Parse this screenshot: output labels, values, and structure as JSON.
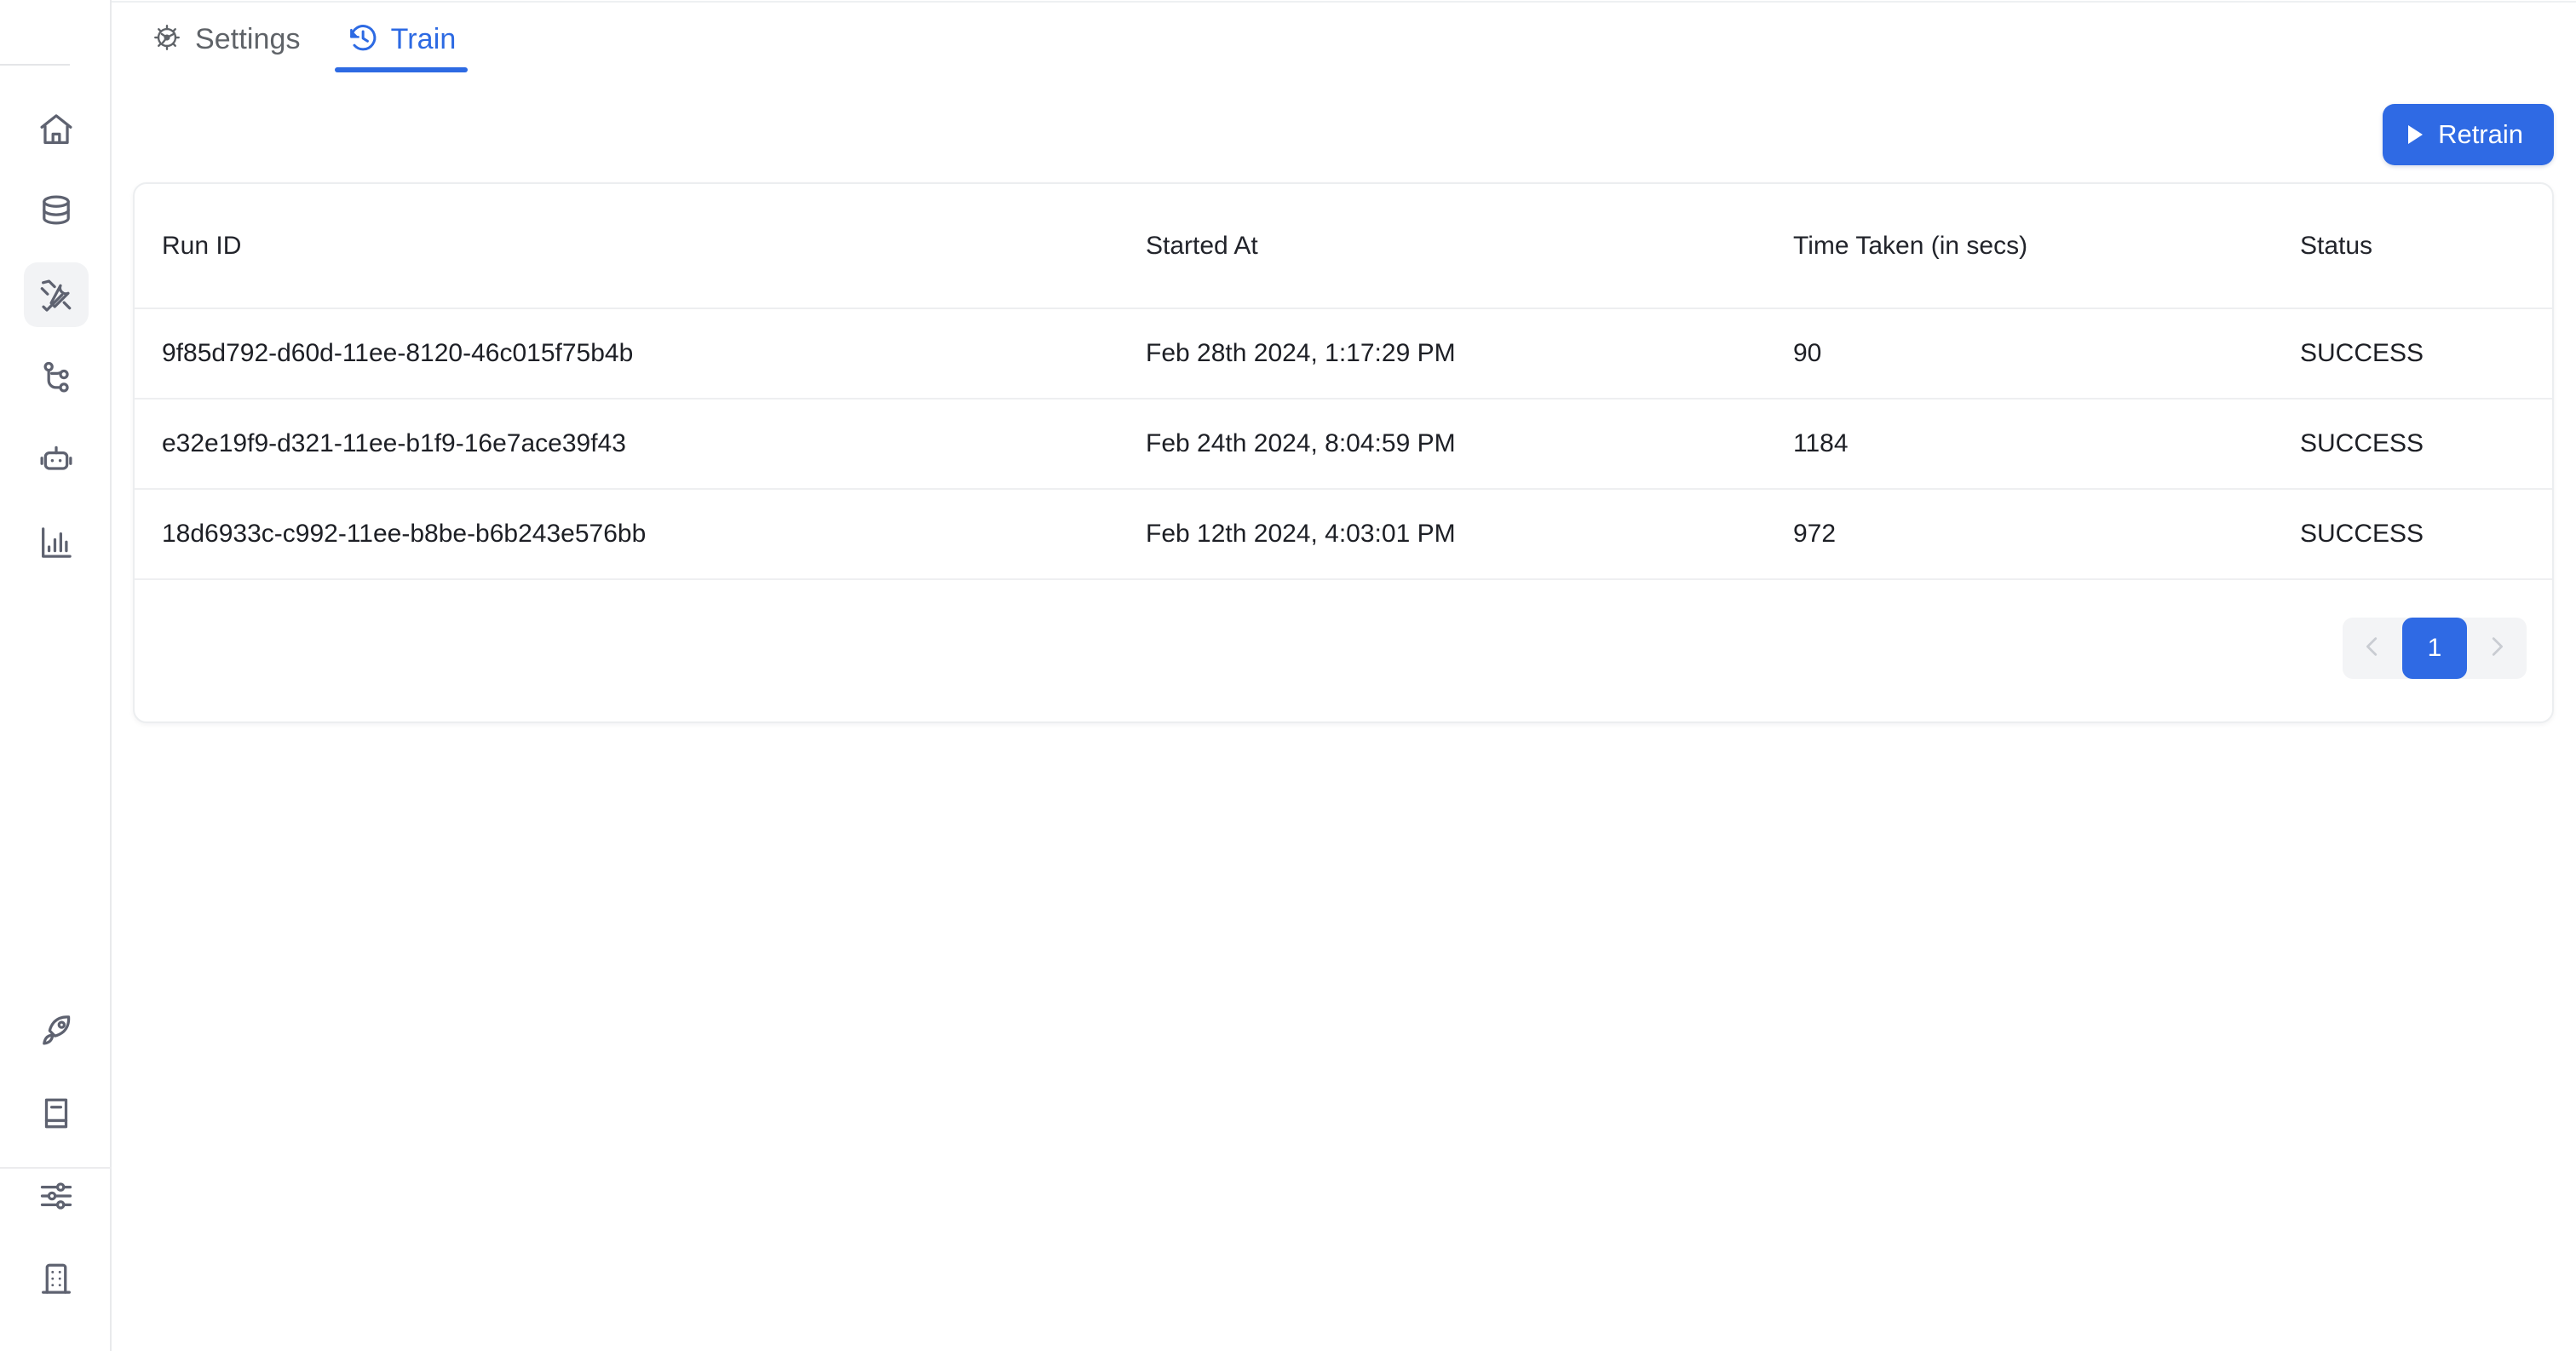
{
  "sidebar": {
    "top_items": [
      {
        "icon": "home-icon",
        "name": "sidebar-item-home",
        "active": false
      },
      {
        "icon": "database-icon",
        "name": "sidebar-item-datasets",
        "active": false
      },
      {
        "icon": "tools-icon",
        "name": "sidebar-item-tools",
        "active": true
      },
      {
        "icon": "git-branch-icon",
        "name": "sidebar-item-pipelines",
        "active": false
      },
      {
        "icon": "robot-icon",
        "name": "sidebar-item-agents",
        "active": false
      },
      {
        "icon": "bar-chart-icon",
        "name": "sidebar-item-analytics",
        "active": false
      }
    ],
    "bottom_items": [
      {
        "icon": "rocket-icon",
        "name": "sidebar-item-deploy",
        "active": false
      },
      {
        "icon": "book-icon",
        "name": "sidebar-item-docs",
        "active": false
      },
      {
        "icon": "sliders-icon",
        "name": "sidebar-item-settings",
        "active": false
      },
      {
        "icon": "building-icon",
        "name": "sidebar-item-organization",
        "active": false
      }
    ]
  },
  "tabs": [
    {
      "label": "Settings",
      "icon": "gear-icon",
      "active": false
    },
    {
      "label": "Train",
      "icon": "history-icon",
      "active": true
    }
  ],
  "toolbar": {
    "retrain_label": "Retrain",
    "retrain_icon": "play-icon"
  },
  "table": {
    "columns": [
      "Run ID",
      "Started At",
      "Time Taken (in secs)",
      "Status"
    ],
    "rows": [
      {
        "run_id": "9f85d792-d60d-11ee-8120-46c015f75b4b",
        "started_at": "Feb 28th 2024, 1:17:29 PM",
        "time_taken": "90",
        "status": "SUCCESS"
      },
      {
        "run_id": "e32e19f9-d321-11ee-b1f9-16e7ace39f43",
        "started_at": "Feb 24th 2024, 8:04:59 PM",
        "time_taken": "1184",
        "status": "SUCCESS"
      },
      {
        "run_id": "18d6933c-c992-11ee-b8be-b6b243e576bb",
        "started_at": "Feb 12th 2024, 4:03:01 PM",
        "time_taken": "972",
        "status": "SUCCESS"
      }
    ]
  },
  "pagination": {
    "prev_icon": "chevron-left-icon",
    "next_icon": "chevron-right-icon",
    "current_page": "1",
    "prev_enabled": false,
    "next_enabled": false
  },
  "colors": {
    "accent": "#2f6ae4",
    "text": "#1d1f25",
    "muted": "#5f6368",
    "border": "#eceef0",
    "active_nav_bg": "#f2f3f5",
    "pager_bg": "#f3f4f6"
  }
}
